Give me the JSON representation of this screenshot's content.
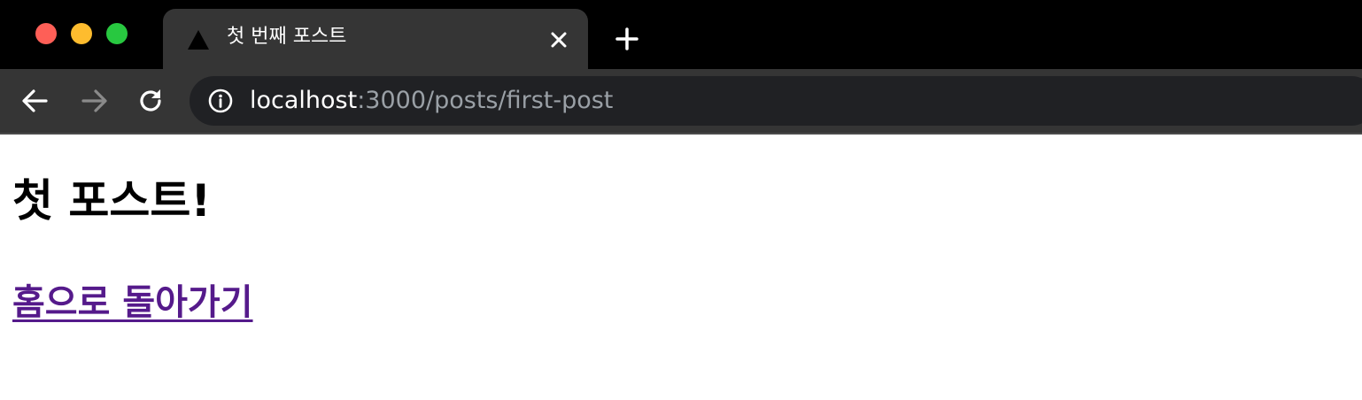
{
  "window": {
    "controls": [
      "close",
      "minimize",
      "maximize"
    ]
  },
  "tab": {
    "title": "첫 번째 포스트",
    "favicon": "triangle-favicon-icon"
  },
  "toolbar": {
    "back_icon": "arrow-left-icon",
    "forward_icon": "arrow-right-icon",
    "reload_icon": "reload-icon",
    "new_tab_icon": "plus-icon",
    "site_info_icon": "info-icon"
  },
  "address_bar": {
    "host": "localhost",
    "rest": ":3000/posts/first-post"
  },
  "page": {
    "title": "첫 포스트!",
    "home_link": "홈으로 돌아가기"
  },
  "colors": {
    "tab_strip": "#000000",
    "toolbar": "#353535",
    "omnibox": "#202124",
    "link_visited": "#551a8b"
  }
}
